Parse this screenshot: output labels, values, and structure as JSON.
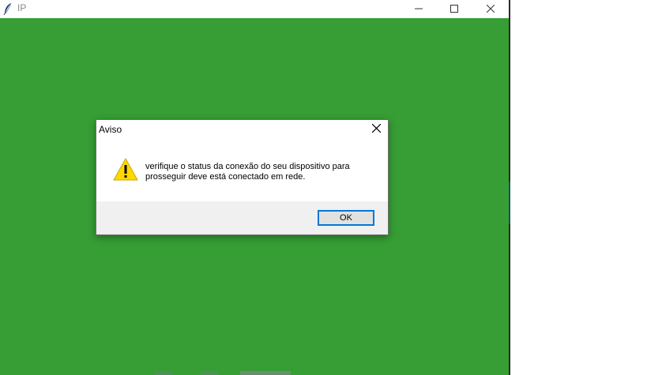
{
  "window": {
    "title": "IP",
    "background_color": "#369e34",
    "icons": {
      "app": "feather-icon",
      "minimize": "minimize-icon",
      "maximize": "maximize-icon",
      "close": "close-icon"
    }
  },
  "dialog": {
    "title": "Aviso",
    "message": "verifique o status da conexão do seu dispositivo para\nprosseguir deve está conectado em rede.",
    "ok_label": "OK",
    "icon": "warning-icon",
    "close_icon": "close-icon",
    "accent_color": "#0078d7"
  }
}
